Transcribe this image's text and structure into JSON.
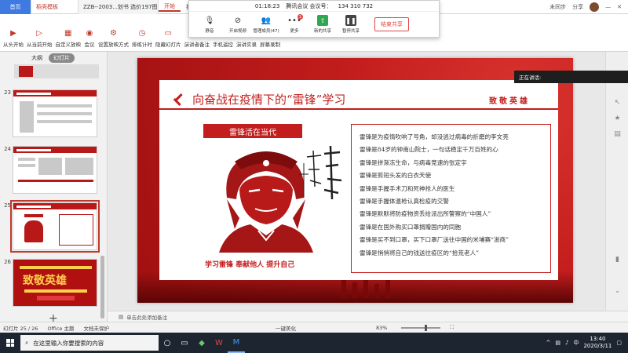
{
  "tabs": {
    "home": "首页",
    "wps": "稻壳模板",
    "doc": "ZZB--2003...划书 选价197图"
  },
  "menu": [
    "开始",
    "插入",
    "设计",
    "切换"
  ],
  "top_right": {
    "collab": "未同步",
    "share": "分享"
  },
  "ribbon": {
    "items": [
      "从头开始",
      "从当前开始",
      "自定义放映",
      "会议",
      "设置放映方式",
      "排练计时",
      "隐藏幻灯片",
      "演讲者备注",
      "手机遥控",
      "演讲实录",
      "屏幕录制"
    ]
  },
  "meeting": {
    "timer": "01:18:23",
    "title": "腾讯会议 会议号：",
    "meeting_id": "134 310 732",
    "buttons": [
      "静音",
      "开启视频",
      "管理成员(47)",
      "更多",
      "新的共享",
      "暂停共享"
    ],
    "more_badge": "1",
    "end_share": "结束共享"
  },
  "speaking": "正在讲话:",
  "sidebar": {
    "tab_outline": "大纲",
    "tab_slides": "幻灯片",
    "slide_numbers": [
      "23",
      "24",
      "25",
      "26"
    ],
    "last_thumb_title": "致敬英雄"
  },
  "slide": {
    "title": "向奋战在疫情下的“雷锋”学习",
    "header_right": "致敬英雄",
    "banner": "雷锋活在当代",
    "slogan": "学习雷锋  奉献他人  提升自己",
    "lines": [
      "雷锋是为疫情吹响了号角，却没逃过病毒的折磨的李文亮",
      "雷锋是84岁的钟南山院士，一句话稳定千万百姓的心",
      "雷锋是拼渐冻生命，与病毒竞速的张定宇",
      "雷锋是剪短头发的白衣天使",
      "雷锋是手握手术刀和死神抢人的医生",
      "雷锋是手握体温枪认真检疫的交警",
      "雷锋是默默将防疫物资丢给派出所警察的“中国人”",
      "雷锋是在国外购买口罩捐赠国内的同胞",
      "雷锋是买不到口罩，买下口罩厂送往中国的米埔赛“浙商”",
      "雷锋是悄悄将自己的钱送往疫区的“拾荒老人”"
    ]
  },
  "notes_placeholder": "单击此处添加备注",
  "status": {
    "slide_pos": "幻灯片 25 / 26",
    "theme": "Office 主题",
    "protect": "文档未保护",
    "beautify": "一键美化",
    "zoom": "83%"
  },
  "taskbar": {
    "search_placeholder": "在这里输入你要搜索的内容",
    "time": "13:40",
    "date": "2020/3/11",
    "lang": "中"
  }
}
